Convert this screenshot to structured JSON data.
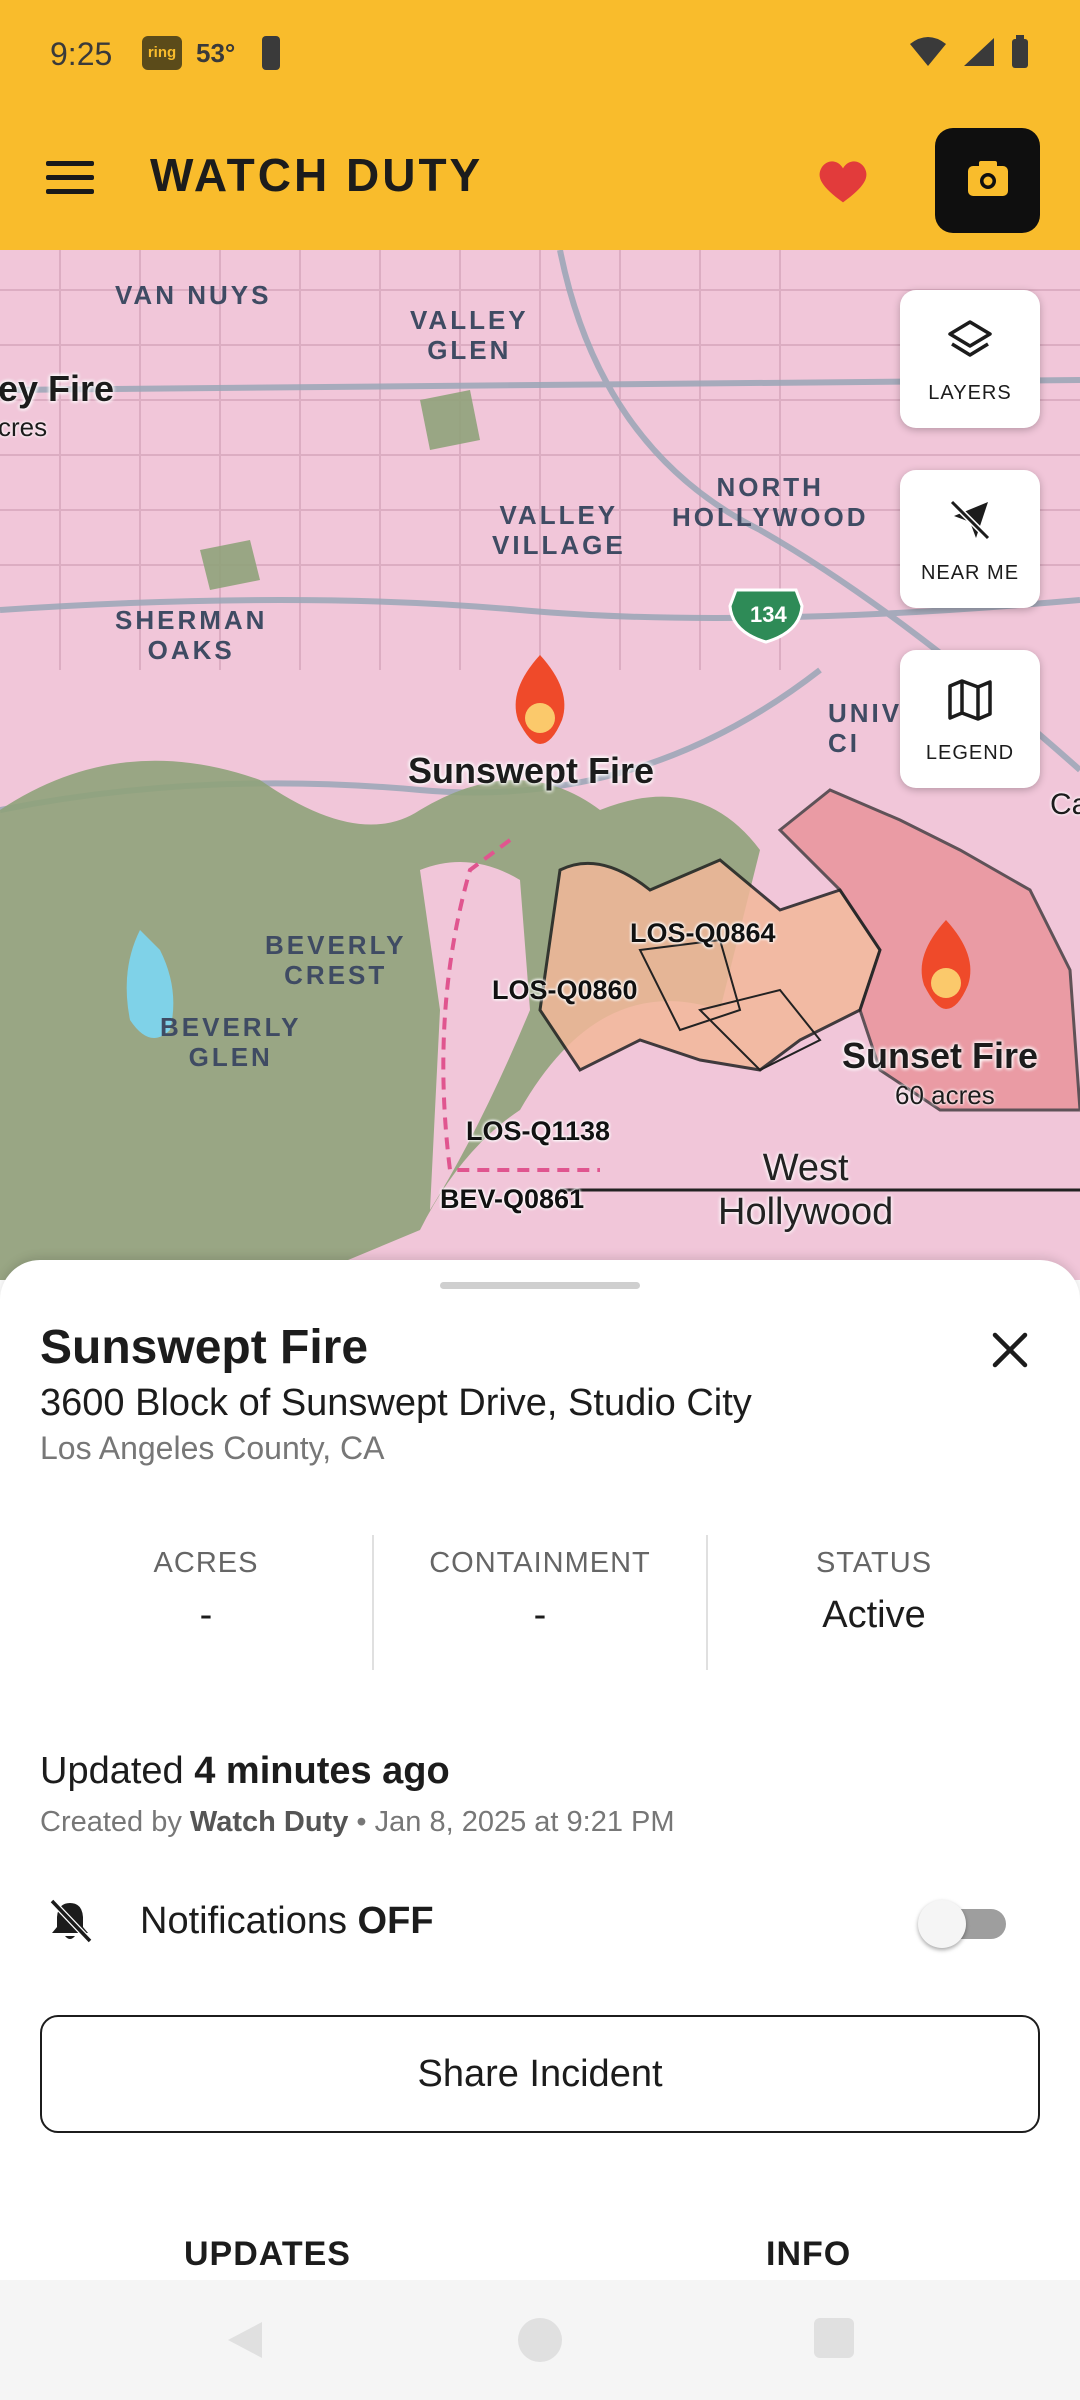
{
  "status_bar": {
    "time": "9:25",
    "ring_badge": "ring",
    "temperature": "53°"
  },
  "app_bar": {
    "logo_text": "WATCH DUTY",
    "brand_color": "#f9bc2c"
  },
  "map": {
    "controls": {
      "layers_label": "LAYERS",
      "near_me_label": "NEAR ME",
      "legend_label": "LEGEND"
    },
    "places": {
      "van_nuys": "VAN NUYS",
      "valley_glen_1": "VALLEY",
      "valley_glen_2": "GLEN",
      "north_hollywood_1": "NORTH",
      "north_hollywood_2": "HOLLYWOOD",
      "valley_village_1": "VALLEY",
      "valley_village_2": "VILLAGE",
      "sherman_oaks_1": "SHERMAN",
      "sherman_oaks_2": "OAKS",
      "universal_1": "UNIV",
      "universal_2": "CI",
      "beverly_crest_1": "BEVERLY",
      "beverly_crest_2": "CREST",
      "beverly_glen_1": "BEVERLY",
      "beverly_glen_2": "GLEN",
      "west_hollywood_1": "West",
      "west_hollywood_2": "Hollywood",
      "edge_ca": "Ca"
    },
    "highway_shield": "134",
    "fires": {
      "left_partial_name": "ey Fire",
      "left_partial_acres": "cres",
      "sunswept_name": "Sunswept Fire",
      "sunset_name": "Sunset Fire",
      "sunset_acres": "60 acres"
    },
    "zones": {
      "q0864": "LOS-Q0864",
      "q0860": "LOS-Q0860",
      "q1138": "LOS-Q1138",
      "bev_q0861": "BEV-Q0861"
    }
  },
  "incident": {
    "name": "Sunswept Fire",
    "address": "3600 Block of Sunswept Drive, Studio City",
    "county": "Los Angeles County, CA",
    "stats": {
      "acres_label": "ACRES",
      "acres_value": "-",
      "containment_label": "CONTAINMENT",
      "containment_value": "-",
      "status_label": "STATUS",
      "status_value": "Active"
    },
    "updated_prefix": "Updated",
    "updated_value": "4 minutes ago",
    "created_prefix": "Created by",
    "created_by": "Watch Duty",
    "created_suffix": "• Jan 8, 2025 at 9:21 PM",
    "notifications_prefix": "Notifications",
    "notifications_state": "OFF",
    "share_label": "Share Incident",
    "tabs": {
      "updates": "UPDATES",
      "info": "INFO"
    }
  }
}
